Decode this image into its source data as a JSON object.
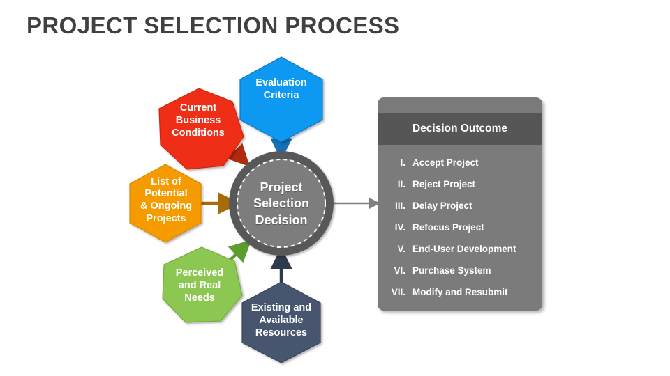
{
  "page": {
    "title": "PROJECT SELECTION PROCESS",
    "background": "#ffffff",
    "title_color": "#404040"
  },
  "center": {
    "name": "project-selection-decision",
    "line1": "Project",
    "line2": "Selection",
    "line3": "Decision",
    "ring_color": "#58585a",
    "fill_color": "#7d7d7d",
    "dash_color": "#ffffff"
  },
  "inputs": [
    {
      "id": "evaluation-criteria",
      "label": "Evaluation\nCriteria",
      "line1": "Evaluation",
      "line2": "Criteria",
      "line3": "",
      "line4": "",
      "shape": "hexagon",
      "fill": "#0d99f2",
      "stroke": "#0b78c4",
      "arrow_color": "#1570b8",
      "arrow_direction": "down"
    },
    {
      "id": "current-business-conditions",
      "label": "Current\nBusiness\nConditions",
      "line1": "Current",
      "line2": "Business",
      "line3": "Conditions",
      "line4": "",
      "shape": "heptagon",
      "fill": "#ee2f12",
      "stroke": "#d42207",
      "arrow_color": "#b02a10",
      "arrow_direction": "down-right"
    },
    {
      "id": "list-of-potential-and-ongoing-projects",
      "label": "List of\nPotential\n& Ongoing\nProjects",
      "line1": "List of",
      "line2": "Potential",
      "line3": "& Ongoing",
      "line4": "Projects",
      "shape": "hexagon",
      "fill": "#f59b00",
      "stroke": "#d98800",
      "arrow_color": "#a86b09",
      "arrow_direction": "right"
    },
    {
      "id": "perceived-and-real-needs",
      "label": "Perceived\nand Real\nNeeds",
      "line1": "Perceived",
      "line2": "and Real",
      "line3": "Needs",
      "line4": "",
      "shape": "heptagon",
      "fill": "#8cc751",
      "stroke": "#74ab3c",
      "arrow_color": "#5d9c2e",
      "arrow_direction": "up-right"
    },
    {
      "id": "existing-and-available-resources",
      "label": "Existing and\nAvailable\nResources",
      "line1": "Existing and",
      "line2": "Available",
      "line3": "Resources",
      "line4": "",
      "shape": "hexagon",
      "fill": "#47566e",
      "stroke": "#36445a",
      "arrow_color": "#2e3a4d",
      "arrow_direction": "up"
    }
  ],
  "output_arrow": {
    "name": "decision-to-outcome-arrow",
    "color": "#808080"
  },
  "panel": {
    "header": "Decision Outcome",
    "header_bg": "#565656",
    "body_bg": "#7b7b7b",
    "frame_bg": "#7a7a7a",
    "items": [
      {
        "num": "I.",
        "text": "Accept Project"
      },
      {
        "num": "II.",
        "text": "Reject Project"
      },
      {
        "num": "III.",
        "text": "Delay Project"
      },
      {
        "num": "IV.",
        "text": "Refocus Project"
      },
      {
        "num": "V.",
        "text": "End-User Development"
      },
      {
        "num": "VI.",
        "text": "Purchase System"
      },
      {
        "num": "VII.",
        "text": "Modify and Resubmit"
      }
    ]
  }
}
